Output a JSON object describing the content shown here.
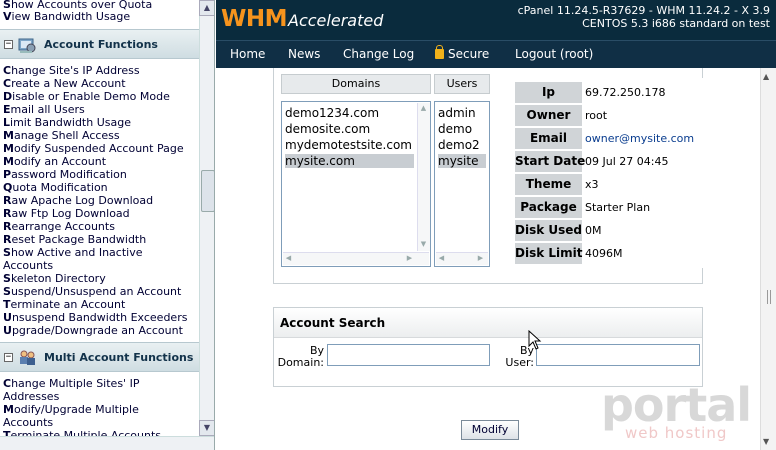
{
  "sidebar": {
    "top_links": [
      {
        "first": "S",
        "rest": "how Accounts over Quota"
      },
      {
        "first": "V",
        "rest": "iew Bandwidth Usage"
      }
    ],
    "section1": {
      "title": "Account Functions",
      "collapse": "−",
      "icon": "account-functions-icon"
    },
    "section1_links": [
      {
        "first": "C",
        "rest": "hange Site's IP Address"
      },
      {
        "first": "C",
        "rest": "reate a New Account"
      },
      {
        "first": "D",
        "rest": "isable or Enable Demo Mode"
      },
      {
        "first": "E",
        "rest": "mail all Users"
      },
      {
        "first": "L",
        "rest": "imit Bandwidth Usage"
      },
      {
        "first": "M",
        "rest": "anage Shell Access"
      },
      {
        "first": "M",
        "rest": "odify Suspended Account Page"
      },
      {
        "first": "M",
        "rest": "odify an Account"
      },
      {
        "first": "P",
        "rest": "assword Modification"
      },
      {
        "first": "Q",
        "rest": "uota Modification"
      },
      {
        "first": "R",
        "rest": "aw Apache Log Download"
      },
      {
        "first": "R",
        "rest": "aw Ftp Log Download"
      },
      {
        "first": "R",
        "rest": "earrange Accounts"
      },
      {
        "first": "R",
        "rest": "eset Package Bandwidth"
      },
      {
        "first": "S",
        "rest": "how Active and Inactive"
      },
      {
        "first": "",
        "rest": "Accounts"
      },
      {
        "first": "S",
        "rest": "keleton Directory"
      },
      {
        "first": "S",
        "rest": "uspend/Unsuspend an Account"
      },
      {
        "first": "T",
        "rest": "erminate an Account"
      },
      {
        "first": "U",
        "rest": "nsuspend Bandwidth Exceeders"
      },
      {
        "first": "U",
        "rest": "pgrade/Downgrade an Account"
      }
    ],
    "section2": {
      "title": "Multi Account Functions",
      "collapse": "−",
      "icon": "multi-account-icon"
    },
    "section2_links": [
      {
        "first": "C",
        "rest": "hange Multiple Sites' IP"
      },
      {
        "first": "",
        "rest": "Addresses"
      },
      {
        "first": "M",
        "rest": "odify/Upgrade Multiple"
      },
      {
        "first": "",
        "rest": "Accounts"
      },
      {
        "first": "T",
        "rest": "erminate Multiple Accounts"
      }
    ]
  },
  "header": {
    "logo_whm": "WHM",
    "logo_accelerated": "Accelerated",
    "version_line1": "cPanel 11.24.5-R37629 - WHM 11.24.2 - X 3.9",
    "version_line2": "CENTOS 5.3 i686 standard on test"
  },
  "nav": {
    "home": "Home",
    "news": "News",
    "changelog": "Change Log",
    "secure": "Secure",
    "logout": "Logout (root)"
  },
  "account_table": {
    "domains_header": "Domains",
    "users_header": "Users",
    "domains": [
      "demo1234.com",
      "demosite.com",
      "mydemotestsite.com",
      "mysite.com"
    ],
    "users": [
      "admin",
      "demo",
      "demo2",
      "mysite"
    ],
    "selected_index": 3
  },
  "info": {
    "ip_label": "Ip",
    "ip": "69.72.250.178",
    "owner_label": "Owner",
    "owner": "root",
    "email_label": "Email",
    "email": "owner@mysite.com",
    "start_label": "Start Date",
    "start": "09 Jul 27 04:45",
    "theme_label": "Theme",
    "theme": "x3",
    "package_label": "Package",
    "package": "Starter Plan",
    "disk_used_label": "Disk Used",
    "disk_used": "0M",
    "disk_limit_label": "Disk Limit",
    "disk_limit": "4096M"
  },
  "search": {
    "title": "Account Search",
    "by_domain_1": "By",
    "by_domain_2": "Domain:",
    "by_user_1": "By",
    "by_user_2": "User:",
    "domain_value": "",
    "user_value": ""
  },
  "modify_label": "Modify",
  "watermark": {
    "brand": "portal",
    "tagline": "web hosting"
  }
}
